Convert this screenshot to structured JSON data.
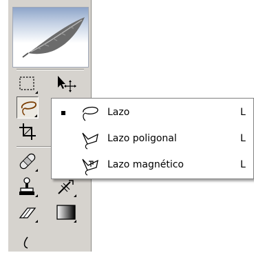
{
  "toolbox": {
    "tools": [
      {
        "name": "marquee-tool",
        "icon": "rectangular-marquee-icon"
      },
      {
        "name": "move-tool",
        "icon": "move-icon"
      },
      {
        "name": "lasso-tool",
        "icon": "lasso-icon",
        "selected": true
      },
      {
        "name": "crop-tool",
        "icon": "crop-icon"
      },
      {
        "name": "healing-brush-tool",
        "icon": "bandage-icon"
      },
      {
        "name": "clone-stamp-tool",
        "icon": "stamp-icon"
      },
      {
        "name": "history-brush-tool",
        "icon": "history-brush-icon"
      },
      {
        "name": "eraser-tool",
        "icon": "eraser-icon"
      },
      {
        "name": "gradient-tool",
        "icon": "gradient-icon"
      }
    ]
  },
  "flyout": {
    "items": [
      {
        "label": "Lazo",
        "shortcut": "L",
        "icon": "lasso-icon",
        "current": true
      },
      {
        "label": "Lazo poligonal",
        "shortcut": "L",
        "icon": "polygonal-lasso-icon",
        "current": false
      },
      {
        "label": "Lazo magnético",
        "shortcut": "L",
        "icon": "magnetic-lasso-icon",
        "current": false
      }
    ]
  },
  "colors": {
    "toolbox_bg": "#d6d3ce",
    "header_blue": "#8ea5c9",
    "menu_bg": "#ffffff"
  }
}
